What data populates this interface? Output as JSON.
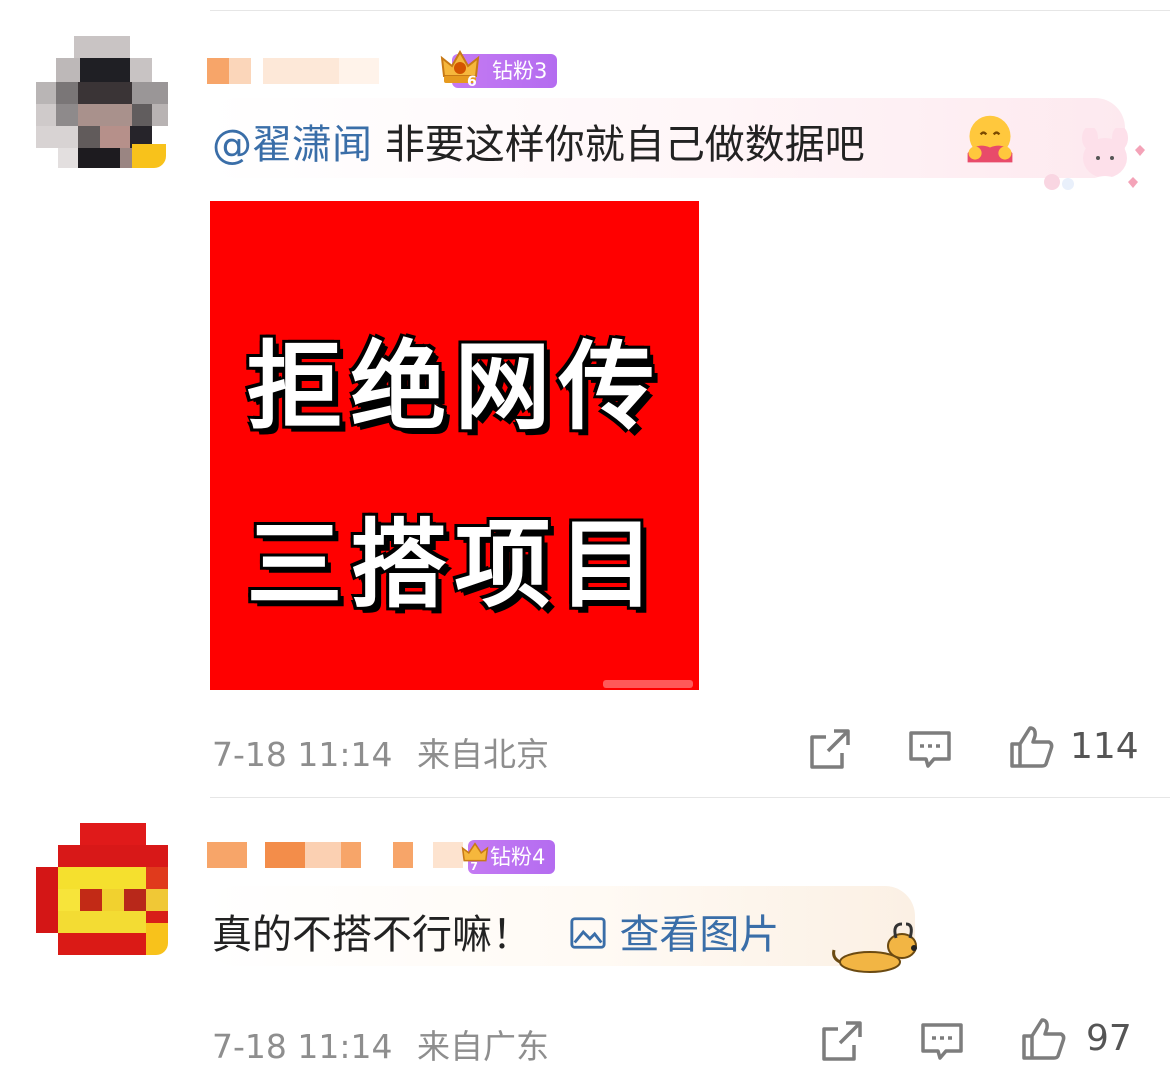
{
  "comments": [
    {
      "badge": "钻粉3",
      "badge_level": "6",
      "mention": "@翟潇闻",
      "text": "非要这样你就自己做数据吧",
      "image_text": [
        "拒绝网传",
        "三搭项目"
      ],
      "time": "7-18 11:14",
      "location": "来自北京",
      "likes": "114"
    },
    {
      "badge": "钻粉4",
      "badge_level": "7",
      "text": "真的不搭不行嘛！",
      "link": "查看图片",
      "time": "7-18 11:14",
      "location": "来自广东",
      "likes": "97"
    }
  ],
  "icons": {
    "share": "share-icon",
    "comment": "comment-icon",
    "like": "thumbs-up-icon"
  },
  "colors": {
    "badge": "#b96ef1",
    "link": "#3a6ea8",
    "image_bg": "#ff0000"
  }
}
